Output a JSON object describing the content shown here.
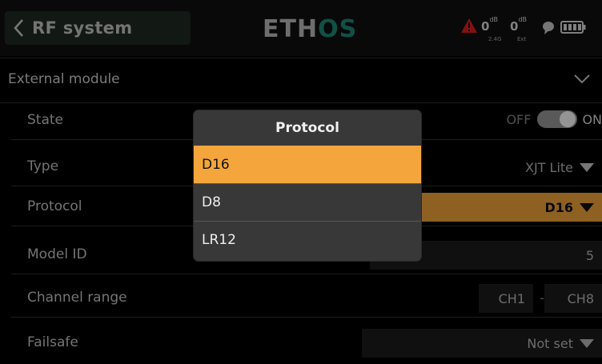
{
  "header": {
    "back_icon": "chevron-left-icon",
    "title": "RF system",
    "logo_part1": "ETH",
    "logo_part2": "OS",
    "warning_icon": "warning-triangle-icon",
    "rssi_24_value": "0",
    "rssi_24_unit": "dB",
    "rssi_24_label": "2.4G",
    "rssi_ext_value": "0",
    "rssi_ext_unit": "dB",
    "rssi_ext_label": "Ext",
    "bt_icon": "bluetooth-icon",
    "battery_icon": "battery-icon"
  },
  "section": {
    "label": "External module",
    "icon": "chevron-down-icon"
  },
  "rows": {
    "state": {
      "label": "State",
      "off": "OFF",
      "on": "ON"
    },
    "type": {
      "label": "Type",
      "value": "XJT Lite"
    },
    "protocol": {
      "label": "Protocol",
      "value": "D16"
    },
    "model_id": {
      "label": "Model ID",
      "value": "5"
    },
    "channel_range": {
      "label": "Channel range",
      "from": "CH1",
      "sep": "-",
      "to": "CH8"
    },
    "failsafe": {
      "label": "Failsafe",
      "value": "Not set"
    }
  },
  "dialog": {
    "title": "Protocol",
    "options": [
      "D16",
      "D8",
      "LR12"
    ],
    "selected": "D16"
  },
  "colors": {
    "accent": "#f4a63c",
    "logo_accent": "#1e8a7a",
    "warning": "#e02020"
  }
}
